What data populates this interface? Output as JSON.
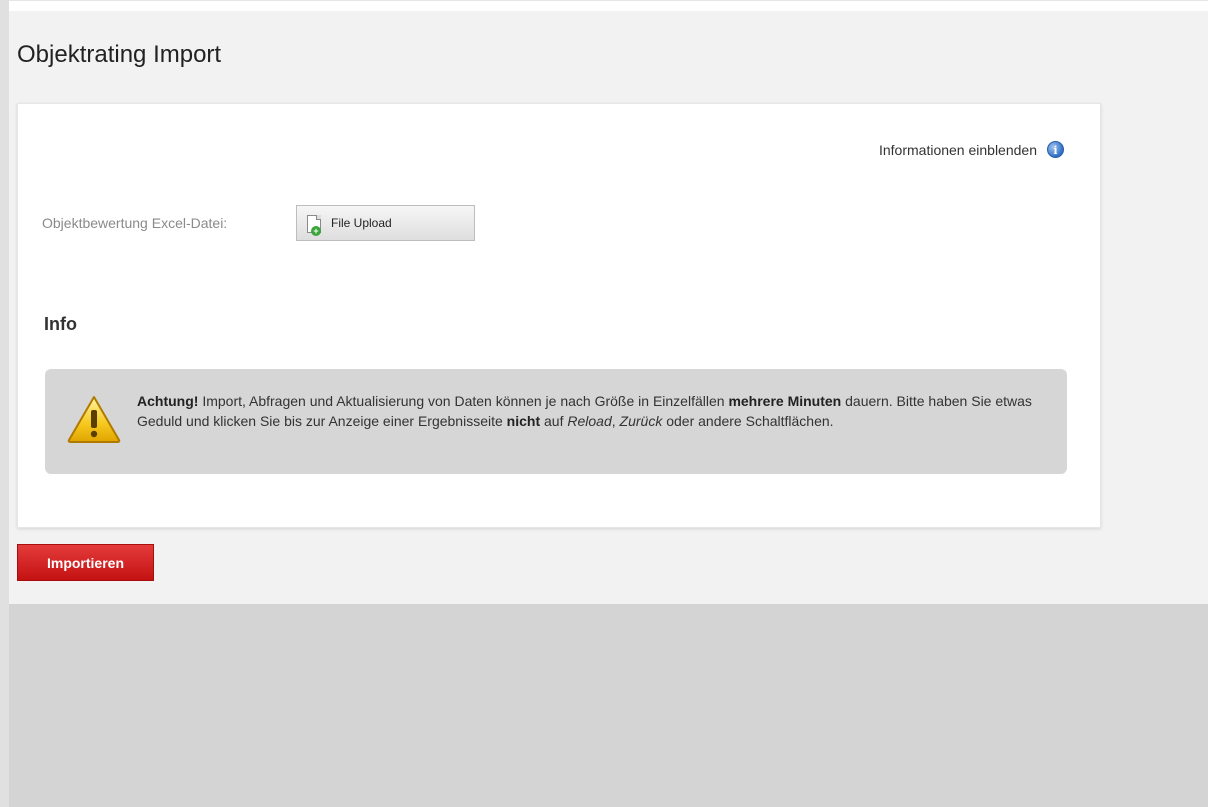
{
  "page": {
    "title": "Objektrating Import"
  },
  "info_toggle": {
    "label": "Informationen einblenden",
    "icon": "info-circle-icon"
  },
  "upload": {
    "label": "Objektbewertung Excel-Datei:",
    "button_label": "File Upload",
    "icon": "file-add-icon"
  },
  "info_section": {
    "heading": "Info",
    "icon": "warning-icon",
    "notice": {
      "part1_bold": "Achtung!",
      "part2": " Import, Abfragen und Aktualisierung von Daten können je nach Größe in Einzelfällen ",
      "part3_bold": "mehrere Minuten",
      "part4": " dauern. Bitte haben Sie etwas Geduld und klicken Sie bis zur Anzeige einer Ergebnisseite ",
      "part5_bold": "nicht",
      "part6": " auf ",
      "part7_italic": "Reload",
      "part8": ", ",
      "part9_italic": "Zurück",
      "part10": " oder andere Schaltflächen."
    }
  },
  "actions": {
    "import_label": "Importieren"
  },
  "colors": {
    "accent": "#d32121",
    "notice_bg": "#d6d6d6",
    "page_bg": "#f2f2f2"
  }
}
